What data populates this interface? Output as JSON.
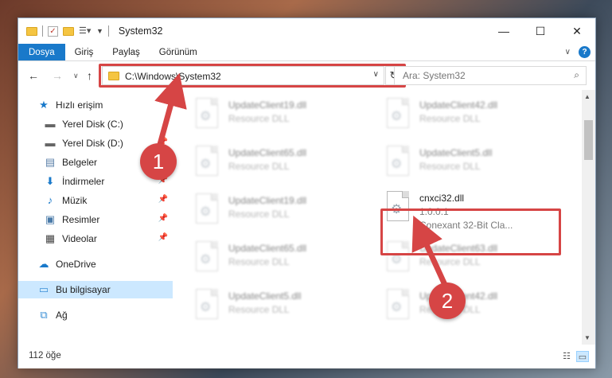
{
  "window": {
    "title": "System32",
    "controls": {
      "minimize": "—",
      "maximize": "☐",
      "close": "✕"
    }
  },
  "ribbon": {
    "tabs": [
      "Dosya",
      "Giriş",
      "Paylaş",
      "Görünüm"
    ],
    "help": "?"
  },
  "navigation": {
    "address": "C:\\Windows\\System32",
    "search_placeholder": "Ara: System32"
  },
  "sidebar": {
    "items": [
      {
        "label": "Hızlı erişim",
        "icon": "star-icon"
      },
      {
        "label": "Yerel Disk (C:)",
        "icon": "drive-icon"
      },
      {
        "label": "Yerel Disk (D:)",
        "icon": "drive-icon",
        "pinned": true
      },
      {
        "label": "Belgeler",
        "icon": "documents-icon",
        "pinned": true
      },
      {
        "label": "İndirmeler",
        "icon": "download-icon",
        "pinned": true
      },
      {
        "label": "Müzik",
        "icon": "music-icon",
        "pinned": true
      },
      {
        "label": "Resimler",
        "icon": "pictures-icon",
        "pinned": true
      },
      {
        "label": "Videolar",
        "icon": "video-icon",
        "pinned": true
      },
      {
        "label": "OneDrive",
        "icon": "cloud-icon"
      },
      {
        "label": "Bu bilgisayar",
        "icon": "computer-icon",
        "selected": true
      },
      {
        "label": "Ağ",
        "icon": "network-icon"
      }
    ]
  },
  "files": [
    {
      "name": "UpdateClient19.dll",
      "type": "Resource DLL"
    },
    {
      "name": "UpdateClient42.dll",
      "type": "Resource DLL"
    },
    {
      "name": "UpdateClient65.dll",
      "type": "Resource DLL"
    },
    {
      "name": "UpdateClient5.dll",
      "type": "Resource DLL"
    },
    {
      "name": "UpdateClient19.dll",
      "type": "Resource DLL"
    },
    {
      "name": "cnxci32.dll",
      "version": "1.0.0.1",
      "description": "Conexant 32-Bit Cla..."
    },
    {
      "name": "UpdateClient65.dll",
      "type": "Resource DLL"
    },
    {
      "name": "UpdateClient63.dll",
      "type": "Resource DLL"
    },
    {
      "name": "UpdateClient5.dll",
      "type": "Resource DLL"
    },
    {
      "name": "UpdateClient42.dll",
      "type": "Resource DLL"
    }
  ],
  "status": {
    "item_count": "112 öğe"
  },
  "annotations": {
    "step1": "1",
    "step2": "2",
    "color": "#d64545"
  }
}
